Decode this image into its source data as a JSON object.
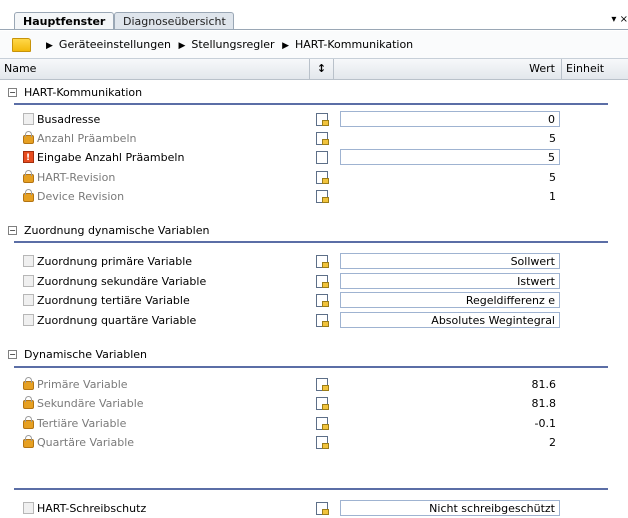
{
  "tabs": [
    {
      "label": "Hauptfenster",
      "active": true
    },
    {
      "label": "Diagnoseübersicht",
      "active": false
    }
  ],
  "tab_menu_glyph": "▾ ×",
  "breadcrumb": {
    "separator": "▶",
    "items": [
      "Geräteeinstellungen",
      "Stellungsregler",
      "HART-Kommunikation"
    ]
  },
  "columns": {
    "name": "Name",
    "sort_glyph": "↕",
    "wert": "Wert",
    "einheit": "Einheit"
  },
  "groups": [
    {
      "label": "HART-Kommunikation",
      "expander": "−",
      "rows": [
        {
          "label": "Busadresse",
          "icon": "document-icon",
          "editable": true,
          "value": "0"
        },
        {
          "label": "Anzahl Präambeln",
          "icon": "lock-icon",
          "editable": false,
          "value": "5"
        },
        {
          "label": "Eingabe Anzahl Präambeln",
          "icon": "warning-icon",
          "editable": true,
          "value": "5"
        },
        {
          "label": "HART-Revision",
          "icon": "lock-icon",
          "editable": false,
          "value": "5"
        },
        {
          "label": "Device Revision",
          "icon": "lock-icon",
          "editable": false,
          "value": "1"
        }
      ]
    },
    {
      "label": "Zuordnung dynamische Variablen",
      "expander": "−",
      "rows": [
        {
          "label": "Zuordnung primäre Variable",
          "icon": "document-icon",
          "editable": true,
          "value": "Sollwert"
        },
        {
          "label": "Zuordnung sekundäre Variable",
          "icon": "document-icon",
          "editable": true,
          "value": "Istwert"
        },
        {
          "label": "Zuordnung tertiäre Variable",
          "icon": "document-icon",
          "editable": true,
          "value": "Regeldifferenz e"
        },
        {
          "label": "Zuordnung quartäre Variable",
          "icon": "document-icon",
          "editable": true,
          "value": "Absolutes Wegintegral"
        }
      ]
    },
    {
      "label": "Dynamische Variablen",
      "expander": "−",
      "rows": [
        {
          "label": "Primäre Variable",
          "icon": "lock-icon",
          "editable": false,
          "value": "81.6"
        },
        {
          "label": "Sekundäre Variable",
          "icon": "lock-icon",
          "editable": false,
          "value": "81.8"
        },
        {
          "label": "Tertiäre Variable",
          "icon": "lock-icon",
          "editable": false,
          "value": "-0.1"
        },
        {
          "label": "Quartäre Variable",
          "icon": "lock-icon",
          "editable": false,
          "value": "2"
        }
      ]
    }
  ],
  "footer_row": {
    "label": "HART-Schreibschutz",
    "icon": "document-icon",
    "editable": true,
    "value": "Nicht schreibgeschützt"
  },
  "colors": {
    "group_line": "#5b6ea6",
    "value_box_border": "#9fb3d1",
    "disabled_text": "#7a7a7a"
  }
}
